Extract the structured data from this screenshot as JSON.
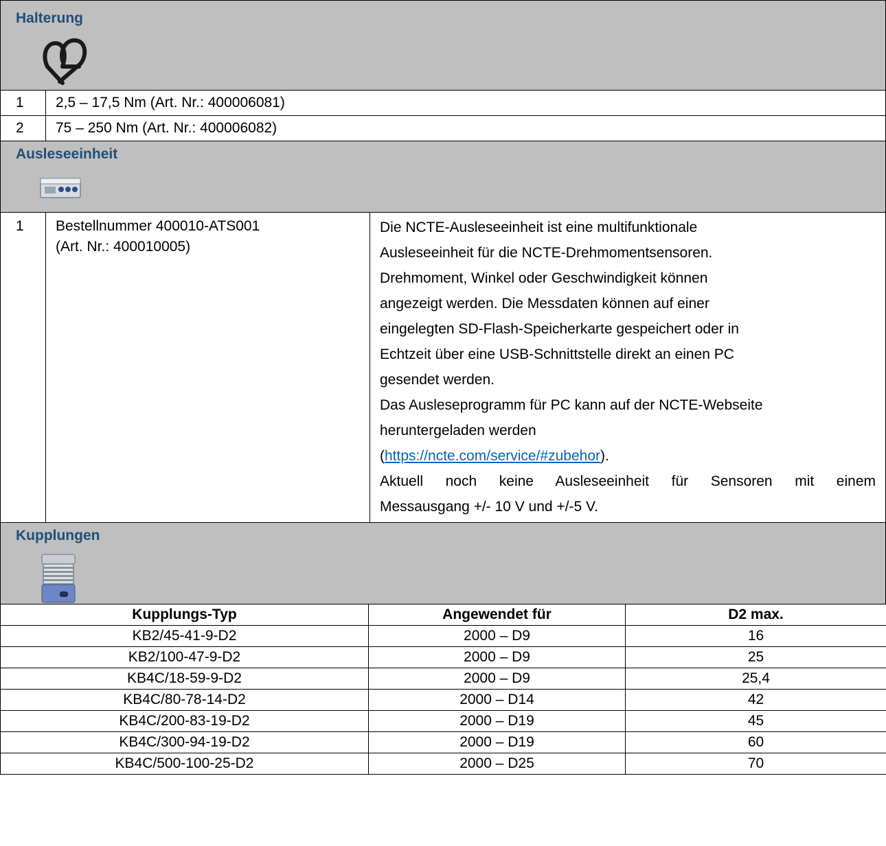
{
  "halterung": {
    "title": "Halterung",
    "icon": "bracket-holder-image",
    "items": [
      {
        "num": "1",
        "text": "2,5 – 17,5 Nm (Art. Nr.: 400006081)"
      },
      {
        "num": "2",
        "text": "75 – 250 Nm (Art. Nr.: 400006082)"
      }
    ]
  },
  "ausleseeinheit": {
    "title": "Ausleseeinheit",
    "icon": "readout-unit-image",
    "item": {
      "num": "1",
      "order_line1": "Bestellnummer 400010-ATS001",
      "order_line2": "(Art. Nr.: 400010005)",
      "desc1": "Die NCTE-Ausleseeinheit ist eine multifunktionale",
      "desc2": "Ausleseeinheit für die NCTE-Drehmomentsensoren.",
      "desc3": "Drehmoment, Winkel oder Geschwindigkeit können",
      "desc4": "angezeigt werden. Die Messdaten können auf einer",
      "desc5": "eingelegten SD-Flash-Speicherkarte gespeichert oder in",
      "desc6": "Echtzeit über eine USB-Schnittstelle direkt an einen PC",
      "desc7": "gesendet werden.",
      "desc8": "Das Ausleseprogramm für PC kann auf der NCTE-Webseite",
      "desc9": "heruntergeladen werden",
      "link_open": "(",
      "link": "https://ncte.com/service/#zubehor",
      "link_close": ").",
      "desc11": "Aktuell noch keine Ausleseeinheit für Sensoren mit einem",
      "desc12": "Messausgang +/- 10 V und +/-5 V."
    }
  },
  "kupplungen": {
    "title": "Kupplungen",
    "icon": "bellows-coupling-image",
    "headers": [
      "Kupplungs-Typ",
      "Angewendet für",
      "D2 max."
    ],
    "rows": [
      [
        "KB2/45-41-9-D2",
        "2000 – D9",
        "16"
      ],
      [
        "KB2/100-47-9-D2",
        "2000 – D9",
        "25"
      ],
      [
        "KB4C/18-59-9-D2",
        "2000 – D9",
        "25,4"
      ],
      [
        "KB4C/80-78-14-D2",
        "2000 – D14",
        "42"
      ],
      [
        "KB4C/200-83-19-D2",
        "2000 – D19",
        "45"
      ],
      [
        "KB4C/300-94-19-D2",
        "2000 – D19",
        "60"
      ],
      [
        "KB4C/500-100-25-D2",
        "2000 – D25",
        "70"
      ]
    ]
  }
}
